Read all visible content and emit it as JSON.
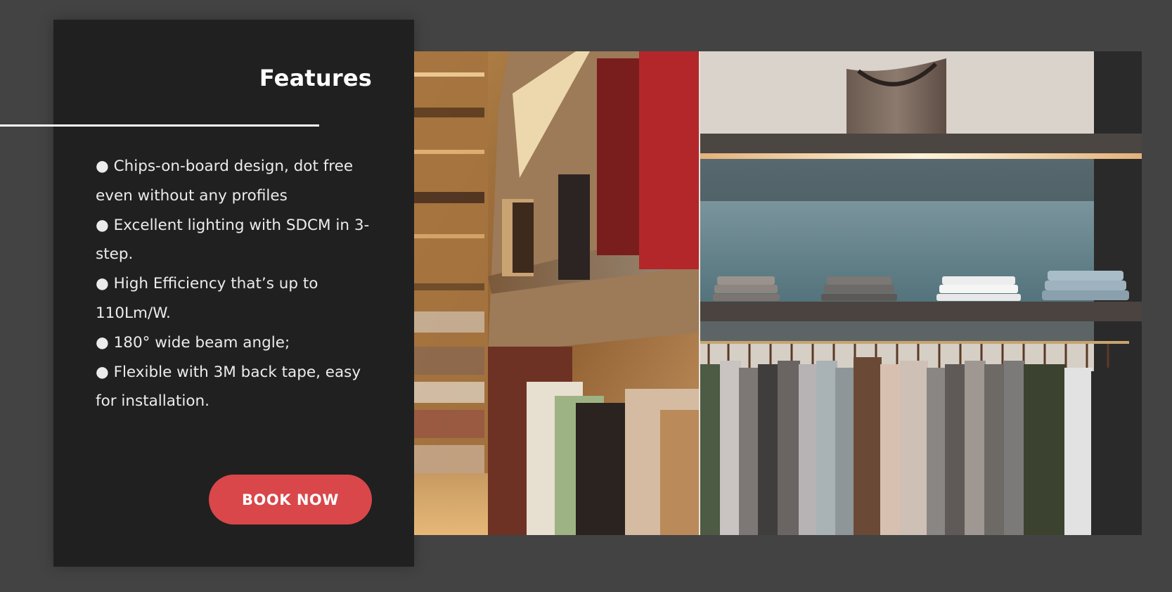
{
  "features": {
    "title": "Features",
    "items": [
      "● Chips-on-board design, dot free even without any profiles",
      "● Excellent lighting with SDCM in 3-step.",
      "● High Efficiency that’s up to 110Lm/W.",
      "● 180° wide beam angle;",
      "● Flexible with 3M back tape, easy for installation."
    ],
    "cta_label": "BOOK NOW"
  },
  "colors": {
    "page_bg": "#434343",
    "panel_bg": "#202020",
    "accent": "#d9474a",
    "text": "#ececec"
  },
  "images": [
    {
      "name": "bookstore-shelves-photo"
    },
    {
      "name": "clothing-store-shelves-photo"
    }
  ]
}
